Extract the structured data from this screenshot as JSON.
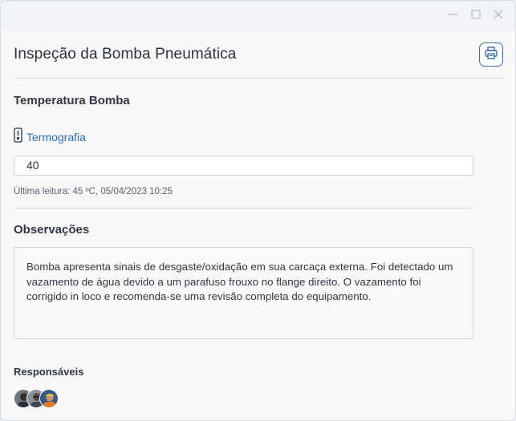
{
  "window": {
    "controls": [
      "minimize-icon",
      "maximize-icon",
      "close-icon"
    ]
  },
  "header": {
    "title": "Inspeção da Bomba Pneumática",
    "print_icon": "printer-icon"
  },
  "temperature": {
    "section_title": "Temperatura Bomba",
    "link_icon": "thermometer-icon",
    "link_label": "Termografia",
    "value": "40",
    "last_reading": "Última leitura: 45 ºC,  05/04/2023 10:25"
  },
  "observations": {
    "section_title": "Observações",
    "text": "Bomba apresenta sinais de desgaste/oxidação em sua carcaça externa. Foi detectado um vazamento de água devido a um parafuso frouxo no flange direito. O vazamento foi corrigido in loco e recomenda-se uma revisão completa do equipamento."
  },
  "responsibles": {
    "label": "Responsáveis",
    "avatars": [
      "avatar-1",
      "avatar-2",
      "avatar-3"
    ]
  },
  "colors": {
    "accent": "#2f6cc4",
    "print_border": "#3a6bb0"
  }
}
